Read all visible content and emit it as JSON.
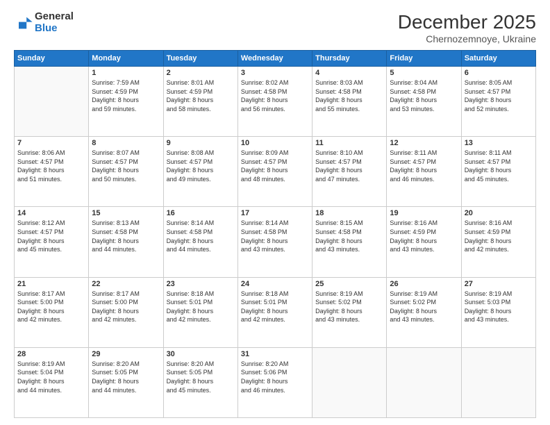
{
  "logo": {
    "general": "General",
    "blue": "Blue"
  },
  "title": "December 2025",
  "subtitle": "Chernozemnoye, Ukraine",
  "weekdays": [
    "Sunday",
    "Monday",
    "Tuesday",
    "Wednesday",
    "Thursday",
    "Friday",
    "Saturday"
  ],
  "weeks": [
    [
      {
        "day": "",
        "info": ""
      },
      {
        "day": "1",
        "info": "Sunrise: 7:59 AM\nSunset: 4:59 PM\nDaylight: 8 hours\nand 59 minutes."
      },
      {
        "day": "2",
        "info": "Sunrise: 8:01 AM\nSunset: 4:59 PM\nDaylight: 8 hours\nand 58 minutes."
      },
      {
        "day": "3",
        "info": "Sunrise: 8:02 AM\nSunset: 4:58 PM\nDaylight: 8 hours\nand 56 minutes."
      },
      {
        "day": "4",
        "info": "Sunrise: 8:03 AM\nSunset: 4:58 PM\nDaylight: 8 hours\nand 55 minutes."
      },
      {
        "day": "5",
        "info": "Sunrise: 8:04 AM\nSunset: 4:58 PM\nDaylight: 8 hours\nand 53 minutes."
      },
      {
        "day": "6",
        "info": "Sunrise: 8:05 AM\nSunset: 4:57 PM\nDaylight: 8 hours\nand 52 minutes."
      }
    ],
    [
      {
        "day": "7",
        "info": "Sunrise: 8:06 AM\nSunset: 4:57 PM\nDaylight: 8 hours\nand 51 minutes."
      },
      {
        "day": "8",
        "info": "Sunrise: 8:07 AM\nSunset: 4:57 PM\nDaylight: 8 hours\nand 50 minutes."
      },
      {
        "day": "9",
        "info": "Sunrise: 8:08 AM\nSunset: 4:57 PM\nDaylight: 8 hours\nand 49 minutes."
      },
      {
        "day": "10",
        "info": "Sunrise: 8:09 AM\nSunset: 4:57 PM\nDaylight: 8 hours\nand 48 minutes."
      },
      {
        "day": "11",
        "info": "Sunrise: 8:10 AM\nSunset: 4:57 PM\nDaylight: 8 hours\nand 47 minutes."
      },
      {
        "day": "12",
        "info": "Sunrise: 8:11 AM\nSunset: 4:57 PM\nDaylight: 8 hours\nand 46 minutes."
      },
      {
        "day": "13",
        "info": "Sunrise: 8:11 AM\nSunset: 4:57 PM\nDaylight: 8 hours\nand 45 minutes."
      }
    ],
    [
      {
        "day": "14",
        "info": "Sunrise: 8:12 AM\nSunset: 4:57 PM\nDaylight: 8 hours\nand 45 minutes."
      },
      {
        "day": "15",
        "info": "Sunrise: 8:13 AM\nSunset: 4:58 PM\nDaylight: 8 hours\nand 44 minutes."
      },
      {
        "day": "16",
        "info": "Sunrise: 8:14 AM\nSunset: 4:58 PM\nDaylight: 8 hours\nand 44 minutes."
      },
      {
        "day": "17",
        "info": "Sunrise: 8:14 AM\nSunset: 4:58 PM\nDaylight: 8 hours\nand 43 minutes."
      },
      {
        "day": "18",
        "info": "Sunrise: 8:15 AM\nSunset: 4:58 PM\nDaylight: 8 hours\nand 43 minutes."
      },
      {
        "day": "19",
        "info": "Sunrise: 8:16 AM\nSunset: 4:59 PM\nDaylight: 8 hours\nand 43 minutes."
      },
      {
        "day": "20",
        "info": "Sunrise: 8:16 AM\nSunset: 4:59 PM\nDaylight: 8 hours\nand 42 minutes."
      }
    ],
    [
      {
        "day": "21",
        "info": "Sunrise: 8:17 AM\nSunset: 5:00 PM\nDaylight: 8 hours\nand 42 minutes."
      },
      {
        "day": "22",
        "info": "Sunrise: 8:17 AM\nSunset: 5:00 PM\nDaylight: 8 hours\nand 42 minutes."
      },
      {
        "day": "23",
        "info": "Sunrise: 8:18 AM\nSunset: 5:01 PM\nDaylight: 8 hours\nand 42 minutes."
      },
      {
        "day": "24",
        "info": "Sunrise: 8:18 AM\nSunset: 5:01 PM\nDaylight: 8 hours\nand 42 minutes."
      },
      {
        "day": "25",
        "info": "Sunrise: 8:19 AM\nSunset: 5:02 PM\nDaylight: 8 hours\nand 43 minutes."
      },
      {
        "day": "26",
        "info": "Sunrise: 8:19 AM\nSunset: 5:02 PM\nDaylight: 8 hours\nand 43 minutes."
      },
      {
        "day": "27",
        "info": "Sunrise: 8:19 AM\nSunset: 5:03 PM\nDaylight: 8 hours\nand 43 minutes."
      }
    ],
    [
      {
        "day": "28",
        "info": "Sunrise: 8:19 AM\nSunset: 5:04 PM\nDaylight: 8 hours\nand 44 minutes."
      },
      {
        "day": "29",
        "info": "Sunrise: 8:20 AM\nSunset: 5:05 PM\nDaylight: 8 hours\nand 44 minutes."
      },
      {
        "day": "30",
        "info": "Sunrise: 8:20 AM\nSunset: 5:05 PM\nDaylight: 8 hours\nand 45 minutes."
      },
      {
        "day": "31",
        "info": "Sunrise: 8:20 AM\nSunset: 5:06 PM\nDaylight: 8 hours\nand 46 minutes."
      },
      {
        "day": "",
        "info": ""
      },
      {
        "day": "",
        "info": ""
      },
      {
        "day": "",
        "info": ""
      }
    ]
  ]
}
